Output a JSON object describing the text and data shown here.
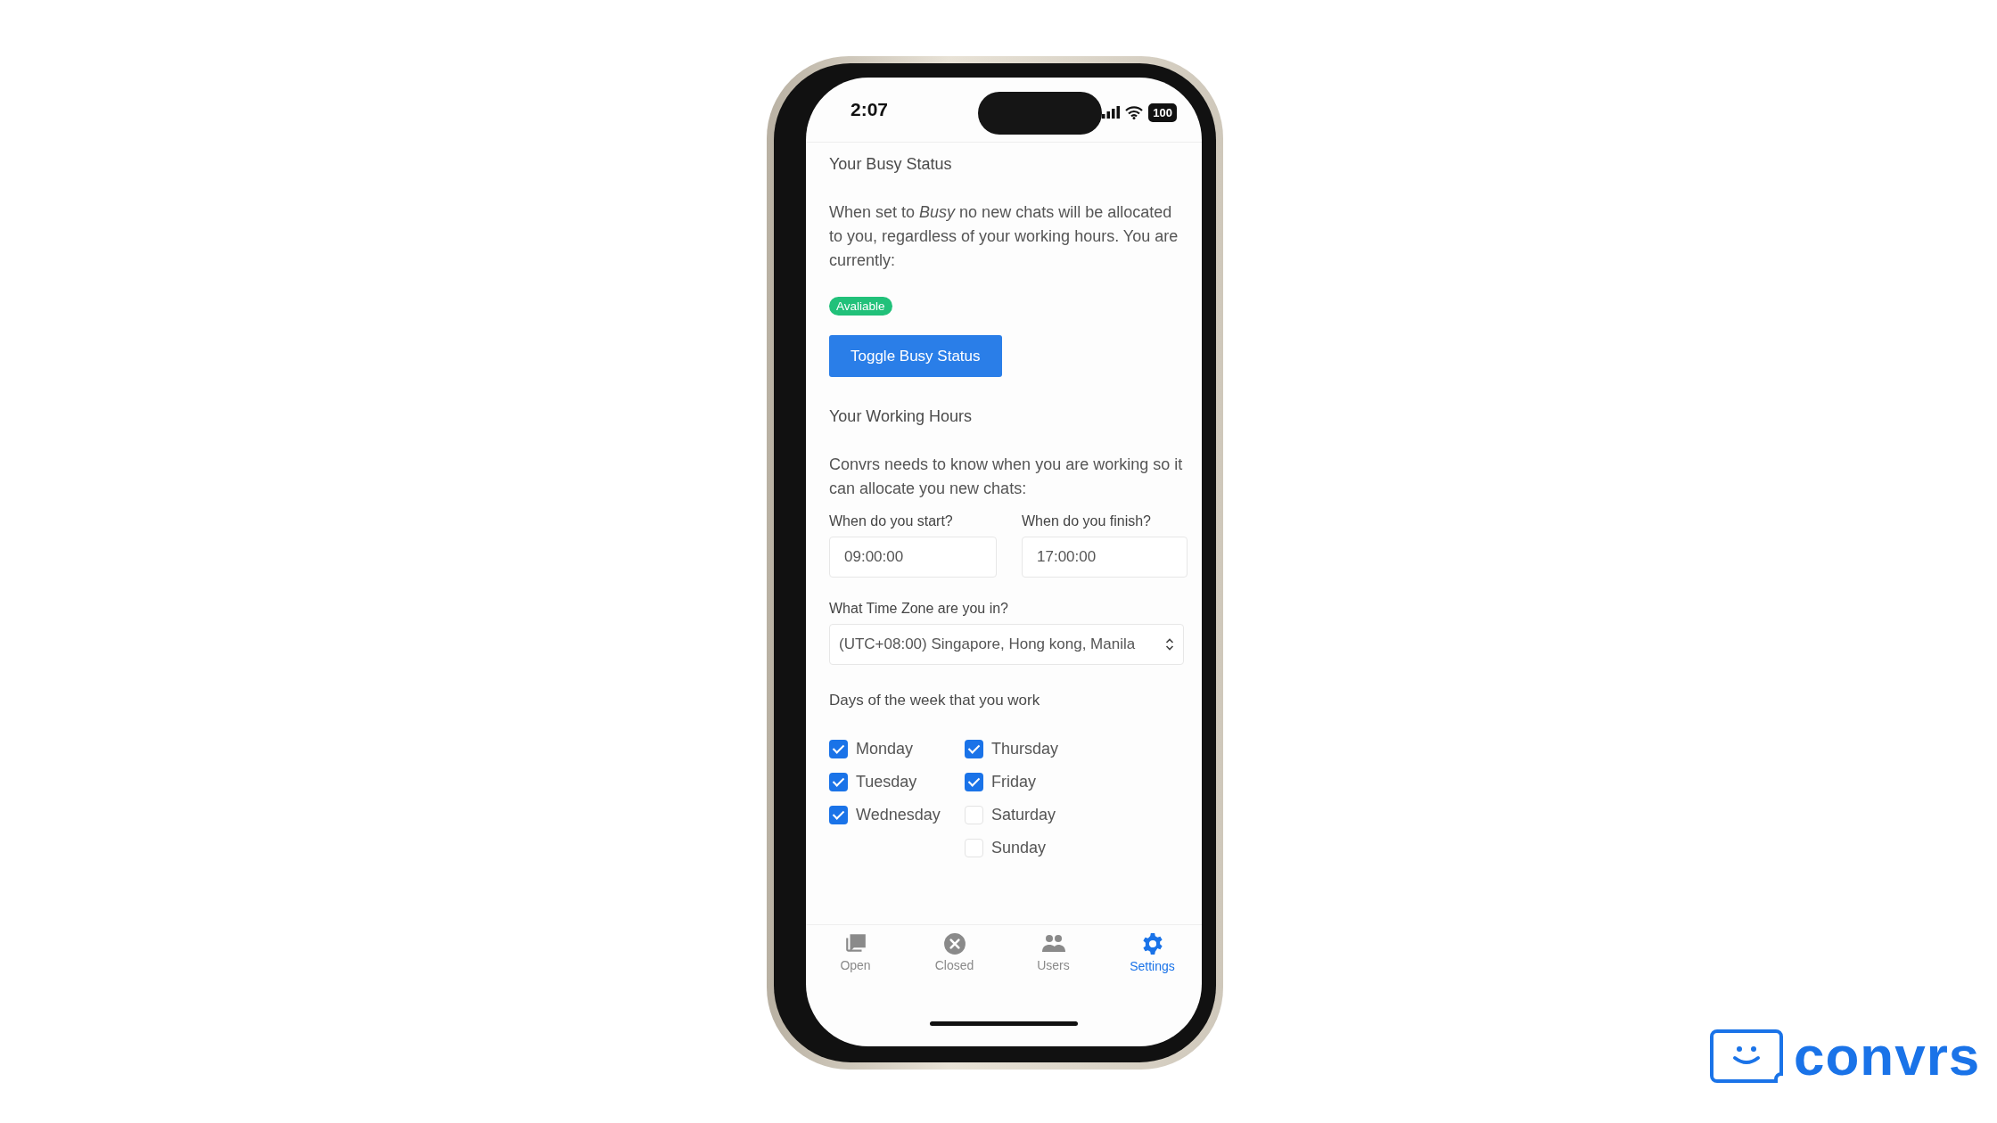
{
  "status_bar": {
    "time": "2:07",
    "battery": "100"
  },
  "busy_status": {
    "heading": "Your Busy Status",
    "description": "When set to *Busy* no new chats will be allocated to you, regardless of your working hours. You are currently:",
    "status": "Avaliable",
    "button": "Toggle Busy Status"
  },
  "working_hours": {
    "heading": "Your Working Hours",
    "description": "Convrs needs to know when you are working so it can allocate you new chats:",
    "start": {
      "label": "When do you start?",
      "value": "09:00:00"
    },
    "finish": {
      "label": "When do you finish?",
      "value": "17:00:00"
    },
    "time_zone": {
      "label": "What Time Zone are you in?",
      "value": "(UTC+08:00) Singapore, Hong kong, Manila"
    },
    "days_heading": "Days of the week that you work",
    "days": [
      {
        "label": "Monday",
        "checked": true
      },
      {
        "label": "Tuesday",
        "checked": true
      },
      {
        "label": "Wednesday",
        "checked": true
      },
      {
        "label": "Thursday",
        "checked": true
      },
      {
        "label": "Friday",
        "checked": true
      },
      {
        "label": "Saturday",
        "checked": false
      },
      {
        "label": "Sunday",
        "checked": false
      }
    ]
  },
  "tab_bar": [
    {
      "kind": "open",
      "label": "Open",
      "selected": false
    },
    {
      "kind": "closed",
      "label": "Closed",
      "selected": false
    },
    {
      "kind": "users",
      "label": "Users",
      "selected": false
    },
    {
      "kind": "settings",
      "label": "Settings",
      "selected": true
    }
  ],
  "brand": {
    "name": "convrs"
  }
}
